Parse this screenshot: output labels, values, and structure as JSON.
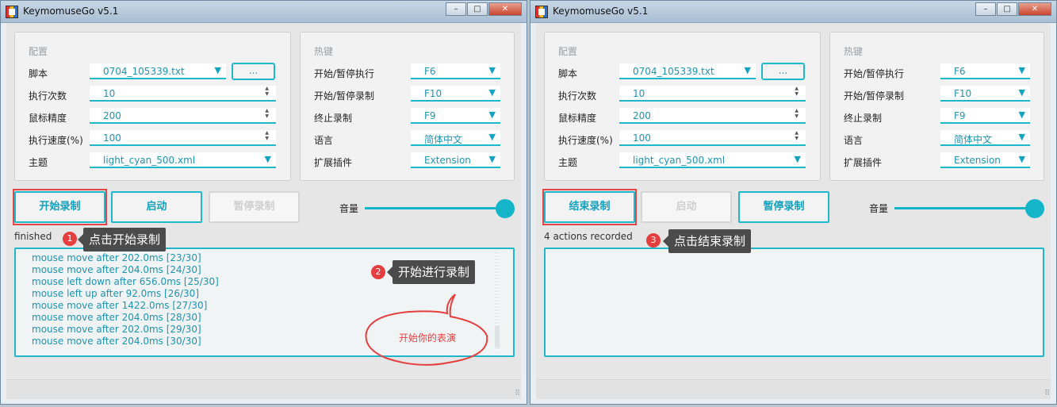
{
  "app_title": "KeymomuseGo v5.1",
  "titlebar": {
    "minimize": "–",
    "maximize": "□",
    "close": "✕"
  },
  "config": {
    "title": "配置",
    "script_label": "脚本",
    "script_value": "0704_105339.txt",
    "browse_label": "...",
    "count_label": "执行次数",
    "count_value": "10",
    "precision_label": "鼠标精度",
    "precision_value": "200",
    "speed_label": "执行速度(%)",
    "speed_value": "100",
    "theme_label": "主题",
    "theme_value": "light_cyan_500.xml"
  },
  "hotkeys": {
    "title": "热键",
    "start_pause_exec_label": "开始/暂停执行",
    "start_pause_exec_value": "F6",
    "start_pause_rec_label": "开始/暂停录制",
    "start_pause_rec_value": "F10",
    "stop_rec_label": "终止录制",
    "stop_rec_value": "F9",
    "language_label": "语言",
    "language_value": "简体中文",
    "plugin_label": "扩展插件",
    "plugin_value": "Extension"
  },
  "volume_label": "音量",
  "left": {
    "record_button": "开始录制",
    "launch_button": "启动",
    "pause_record_button": "暂停录制",
    "status": "finished",
    "log": [
      "mouse move after 202.0ms [23/30]",
      "mouse move after 204.0ms [24/30]",
      "mouse left down after 656.0ms [25/30]",
      "mouse left up after 92.0ms [26/30]",
      "mouse move after 1422.0ms [27/30]",
      "mouse move after 204.0ms [28/30]",
      "mouse move after 202.0ms [29/30]",
      "mouse move after 204.0ms [30/30]"
    ],
    "annotation1_num": "1",
    "annotation1_text": "点击开始录制",
    "annotation2_num": "2",
    "annotation2_text": "开始进行录制",
    "callout_text": "开始你的表演"
  },
  "right": {
    "record_button": "结束录制",
    "launch_button": "启动",
    "pause_record_button": "暂停录制",
    "status": "4 actions recorded",
    "annotation3_num": "3",
    "annotation3_text": "点击结束录制"
  },
  "colors": {
    "accent": "#1fb7cc",
    "annotation_red": "#e53e3e",
    "tooltip_bg": "#4b4b4b"
  }
}
